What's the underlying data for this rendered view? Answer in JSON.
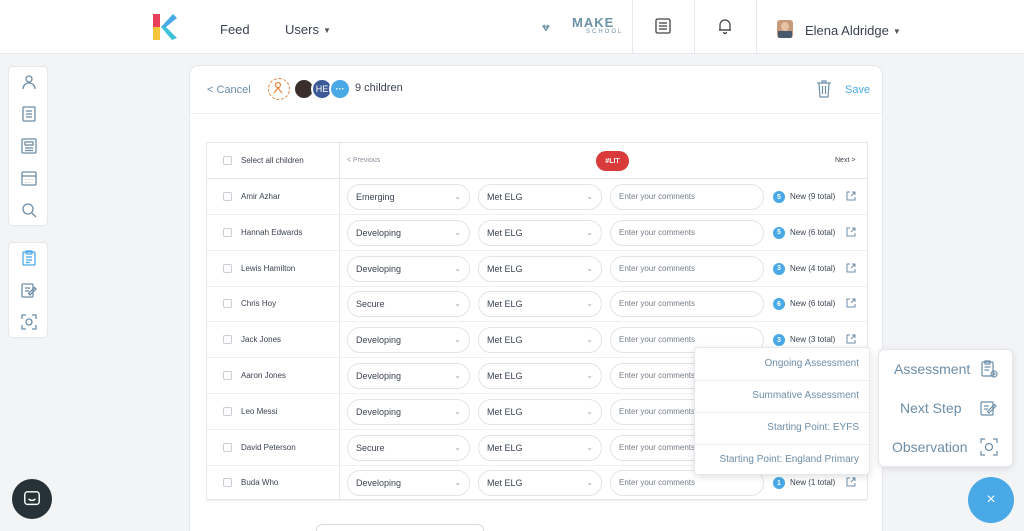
{
  "topbar": {
    "feed_label": "Feed",
    "users_label": "Users",
    "brand_main": "MAKE",
    "brand_sub": "SCHOOL",
    "user_name": "Elena Aldridge",
    "accent_color": "#48a9e6"
  },
  "sidebar": {
    "group1": [
      "user-icon",
      "document-icon",
      "news-icon",
      "calendar-icon",
      "search-icon"
    ],
    "group2": [
      "clipboard-icon",
      "edit-note-icon",
      "scan-icon"
    ]
  },
  "card": {
    "cancel_label": "< Cancel",
    "selected_label": "9 children",
    "avatar_initials": "HE",
    "more_label": "···",
    "save_label": "Save"
  },
  "table": {
    "select_all_label": "Select all children",
    "previous_label": "< Previous",
    "tag_label": "#LIT",
    "next_label": "Next >",
    "comment_placeholder": "Enter your comments",
    "rows": [
      {
        "name": "Amir Azhar",
        "level": "Emerging",
        "elg": "Met ELG",
        "count": "5",
        "status": "New (9 total)"
      },
      {
        "name": "Hannah Edwards",
        "level": "Developing",
        "elg": "Met ELG",
        "count": "5",
        "status": "New (6 total)"
      },
      {
        "name": "Lewis Hamilton",
        "level": "Developing",
        "elg": "Met ELG",
        "count": "3",
        "status": "New (4 total)"
      },
      {
        "name": "Chris Hoy",
        "level": "Secure",
        "elg": "Met ELG",
        "count": "6",
        "status": "New (6 total)"
      },
      {
        "name": "Jack Jones",
        "level": "Developing",
        "elg": "Met ELG",
        "count": "3",
        "status": "New (3 total)"
      },
      {
        "name": "Aaron Jones",
        "level": "Developing",
        "elg": "Met ELG",
        "count": "",
        "status": ""
      },
      {
        "name": "Leo Messi",
        "level": "Developing",
        "elg": "Met ELG",
        "count": "",
        "status": ""
      },
      {
        "name": "David Peterson",
        "level": "Secure",
        "elg": "Met ELG",
        "count": "",
        "status": ""
      },
      {
        "name": "Buda Who",
        "level": "Developing",
        "elg": "Met ELG",
        "count": "1",
        "status": "New (1 total)"
      }
    ]
  },
  "assessment_menu": {
    "items": [
      "Ongoing Assessment",
      "Summative Assessment",
      "Starting Point: EYFS",
      "Starting Point: England Primary"
    ]
  },
  "fab_menu": {
    "items": [
      {
        "label": "Assessment",
        "icon": "assessment-icon"
      },
      {
        "label": "Next Step",
        "icon": "next-step-icon"
      },
      {
        "label": "Observation",
        "icon": "observation-icon"
      }
    ],
    "close_label": "×"
  }
}
